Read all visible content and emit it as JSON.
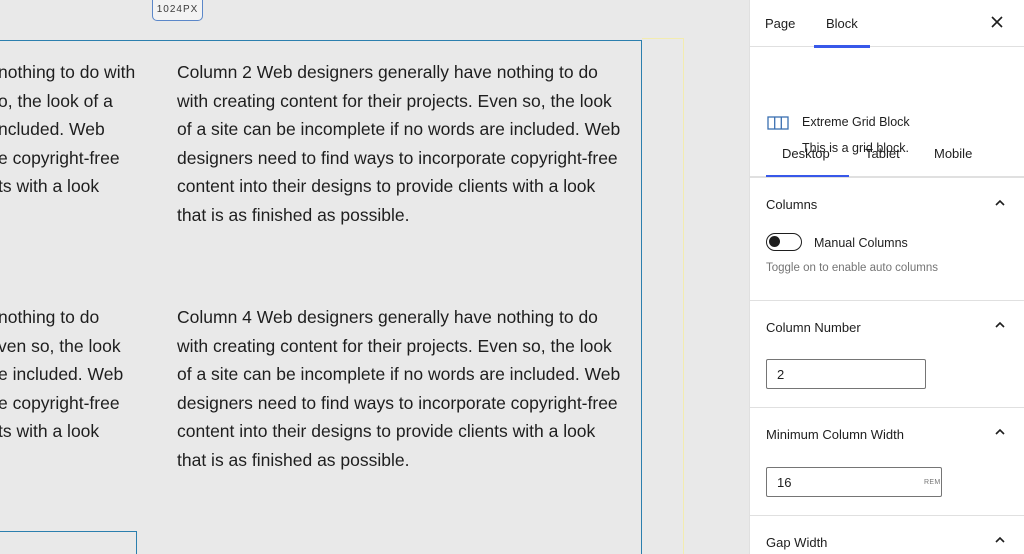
{
  "canvas": {
    "width_badge": "1024PX",
    "columns": [
      {
        "id": "col1-partial",
        "lines": [
          "nothing to do with",
          "o, the look of a",
          "ncluded. Web",
          "e copyright-free",
          "ts with a look"
        ]
      },
      {
        "id": "col2",
        "lines": [
          "Column 2 Web designers generally have nothing to do",
          "with creating content for their projects. Even so, the look",
          "of a site can be incomplete if no words are included. Web",
          "designers need to find ways to incorporate copyright-free",
          "content into their designs to provide clients with a look",
          "that is as finished as possible."
        ]
      },
      {
        "id": "col3-partial",
        "lines": [
          "nothing to do",
          "ven so, the look",
          "e included. Web",
          "e copyright-free",
          "ts with a look"
        ]
      },
      {
        "id": "col4",
        "lines": [
          "Column 4 Web designers generally have nothing to do",
          "with creating content for their projects. Even so, the look",
          "of a site can be incomplete if no words are included. Web",
          "designers need to find ways to incorporate copyright-free",
          "content into their designs to provide clients with a look",
          "that is as finished as possible."
        ]
      }
    ]
  },
  "sidebar": {
    "tabs": [
      "Page",
      "Block"
    ],
    "active_tab": "Block",
    "block": {
      "title": "Extreme Grid Block",
      "description": "This is a grid block.",
      "icon": "columns-icon"
    },
    "device_tabs": [
      "Desktop",
      "Tablet",
      "Mobile"
    ],
    "active_device": "Desktop",
    "columns_panel": {
      "title": "Columns",
      "toggle_label": "Manual Columns",
      "toggle_on": false,
      "help": "Toggle on to enable auto columns"
    },
    "column_number_panel": {
      "title": "Column Number",
      "value": "2"
    },
    "min_width_panel": {
      "title": "Minimum Column Width",
      "value": "16",
      "unit": "REM"
    },
    "gap_panel": {
      "title": "Gap Width"
    },
    "accent_color": "#3858e9",
    "block_border_color": "#2b7fae"
  }
}
